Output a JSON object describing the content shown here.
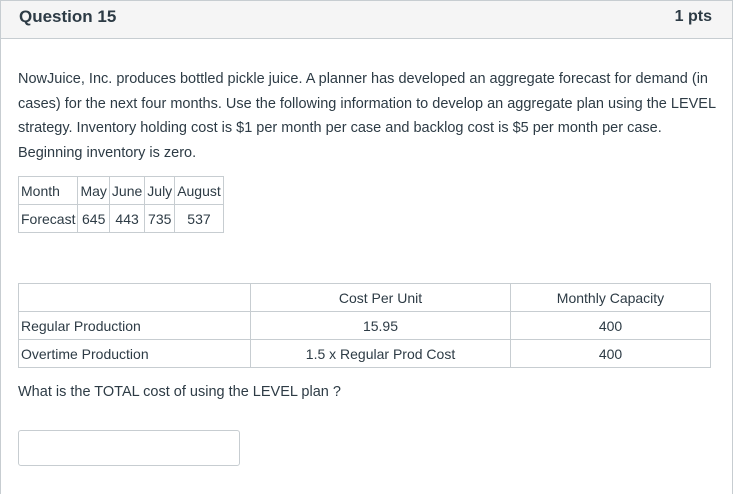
{
  "header": {
    "title": "Question 15",
    "points": "1 pts"
  },
  "body": {
    "text": "NowJuice, Inc. produces bottled pickle juice.  A planner has developed an aggregate forecast for demand (in cases) for the next four months.  Use the following information to develop an aggregate plan using the LEVEL strategy.  Inventory holding cost is $1 per month per case and backlog cost is $5 per month per case.  Beginning inventory is zero."
  },
  "forecast_table": {
    "header_row": [
      "Month",
      "May",
      "June",
      "July",
      "August"
    ],
    "data_row": [
      "Forecast",
      "645",
      "443",
      "735",
      "537"
    ]
  },
  "cost_table": {
    "headers": [
      "",
      "Cost Per Unit",
      "Monthly Capacity"
    ],
    "rows": [
      [
        "Regular Production",
        "15.95",
        "400"
      ],
      [
        "Overtime Production",
        "1.5  x Regular Prod Cost",
        "400"
      ]
    ]
  },
  "prompt": "What is the TOTAL cost of using the LEVEL plan ?",
  "answer": {
    "value": "",
    "placeholder": ""
  }
}
